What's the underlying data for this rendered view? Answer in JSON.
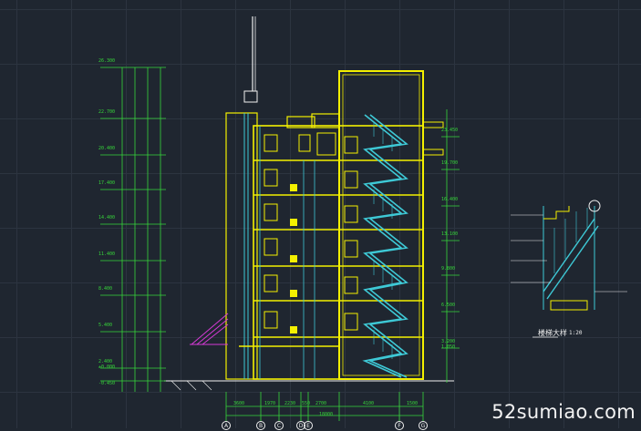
{
  "colors": {
    "background": "#1f2630",
    "wall": "#f4f000",
    "dimension": "#36d63a",
    "stair": "#3ec9d6",
    "accent": "#d63ad6",
    "axis": "#f0f0f0"
  },
  "left_elevations": [
    "26.300",
    "22.700",
    "20.400",
    "17.400",
    "14.400",
    "11.400",
    "8.400",
    "5.400",
    "2.400",
    "±0.000",
    "-0.450"
  ],
  "right_elevations": [
    "23.450",
    "19.700",
    "16.400",
    "13.100",
    "9.800",
    "6.500",
    "3.200",
    "1.050"
  ],
  "bottom_dimensions": [
    "3600",
    "1970",
    "2230",
    "550",
    "2700",
    "4100",
    "1500"
  ],
  "bottom_total": "18000",
  "axis_labels": [
    "A",
    "B",
    "C",
    "D",
    "E",
    "F",
    "G"
  ],
  "detail": {
    "title": "楼梯大样",
    "scale": "1:20"
  },
  "watermark": "52sumiao.com"
}
